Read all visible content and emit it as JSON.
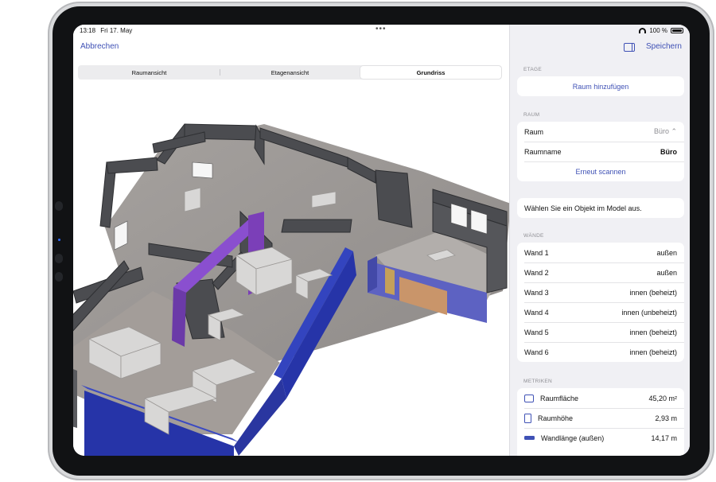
{
  "status": {
    "time": "13:18",
    "date": "Fri 17. May",
    "dots": "•••",
    "battery": "100 %"
  },
  "nav": {
    "cancel_label": "Abbrechen",
    "save_label": "Speichern"
  },
  "tabs": [
    {
      "label": "Raumansicht",
      "active": false
    },
    {
      "label": "Etagenansicht",
      "active": false
    },
    {
      "label": "Grundriss",
      "active": true
    }
  ],
  "panel": {
    "etage": {
      "heading": "ETAGE",
      "add_room_label": "Raum hinzufügen"
    },
    "raum": {
      "heading": "RAUM",
      "room_label": "Raum",
      "room_value": "Büro ⌃",
      "name_label": "Raumname",
      "name_value": "Büro",
      "rescan_label": "Erneut scannen"
    },
    "hint": "Wählen Sie ein Objekt im Model aus.",
    "walls": {
      "heading": "WÄNDE",
      "items": [
        {
          "label": "Wand 1",
          "value": "außen"
        },
        {
          "label": "Wand 2",
          "value": "außen"
        },
        {
          "label": "Wand 3",
          "value": "innen (beheizt)"
        },
        {
          "label": "Wand 4",
          "value": "innen (unbeheizt)"
        },
        {
          "label": "Wand 5",
          "value": "innen (beheizt)"
        },
        {
          "label": "Wand 6",
          "value": "innen (beheizt)"
        }
      ]
    },
    "metrics": {
      "heading": "METRIKEN",
      "items": [
        {
          "icon": "area-icon",
          "label": "Raumfläche",
          "value": "45,20 m²"
        },
        {
          "icon": "height-icon",
          "label": "Raumhöhe",
          "value": "2,93 m"
        },
        {
          "icon": "length-icon",
          "label": "Wandlänge (außen)",
          "value": "14,17 m"
        }
      ]
    }
  },
  "colors": {
    "accent": "#3f51b5",
    "selected_wall_blue": "#2634a8",
    "purple_wall": "#7b3fb8",
    "window_orange": "#c9956a"
  }
}
